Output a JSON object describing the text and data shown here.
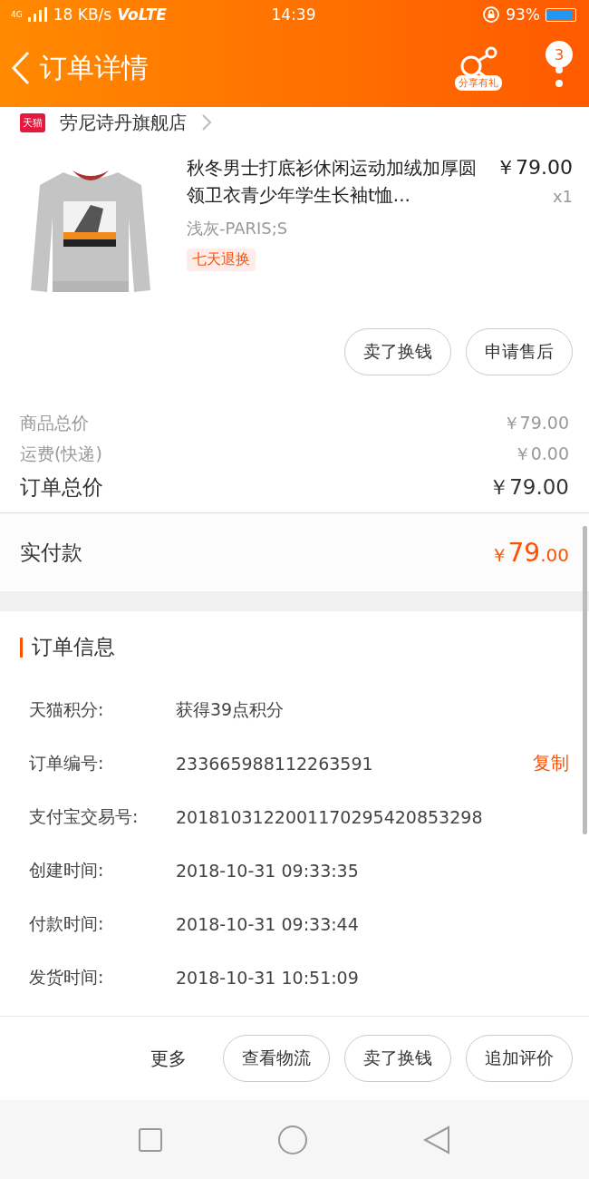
{
  "status_bar": {
    "network": "4G",
    "speed": "18 KB/s",
    "volte": "VoLTE",
    "time": "14:39",
    "battery": "93%"
  },
  "header": {
    "title": "订单详情",
    "share_label": "分享有礼",
    "badge": "3"
  },
  "shop": {
    "tag": "天猫",
    "name": "劳尼诗丹旗舰店"
  },
  "product": {
    "kind": "picture",
    "title": "秋冬男士打底衫休闲运动加绒加厚圆领卫衣青少年学生长袖t恤...",
    "price": "￥79.00",
    "quantity": "x1",
    "variant": "浅灰-PARIS;S",
    "tag": "七天退换"
  },
  "item_buttons": [
    "卖了换钱",
    "申请售后"
  ],
  "costs": [
    {
      "label": "商品总价",
      "value": "￥79.00"
    },
    {
      "label": "运费(快递)",
      "value": "￥0.00"
    }
  ],
  "order_total": {
    "label": "订单总价",
    "value": "￥79.00"
  },
  "paid": {
    "label": "实付款",
    "currency": "￥",
    "integer": "79",
    "decimals": ".00"
  },
  "order_info": {
    "title": "订单信息",
    "rows": [
      {
        "label": "天猫积分:",
        "value": "获得39点积分"
      },
      {
        "label": "订单编号:",
        "value": "233665988112263591",
        "action": "复制"
      },
      {
        "label": "支付宝交易号:",
        "value": "2018103122001170295420853298"
      },
      {
        "label": "创建时间:",
        "value": "2018-10-31 09:33:35"
      },
      {
        "label": "付款时间:",
        "value": "2018-10-31 09:33:44"
      },
      {
        "label": "发货时间:",
        "value": "2018-10-31 10:51:09"
      }
    ]
  },
  "bottom_bar": {
    "more": "更多",
    "buttons": [
      "查看物流",
      "卖了换钱",
      "追加评价"
    ]
  }
}
